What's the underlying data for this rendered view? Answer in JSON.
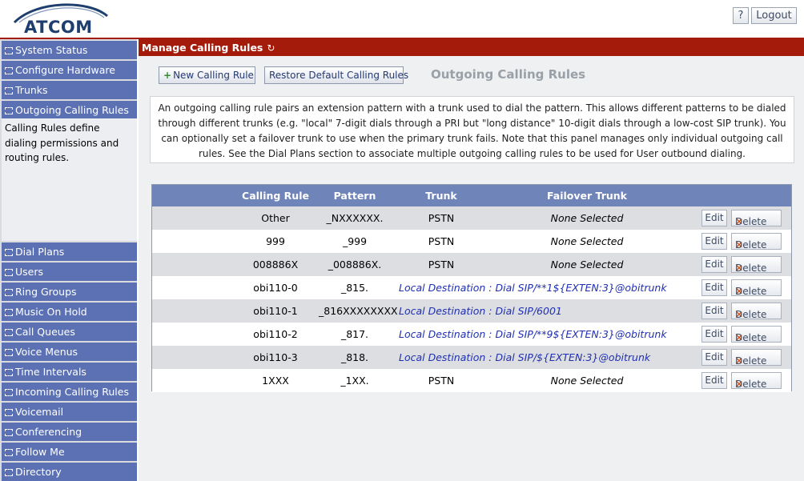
{
  "header": {
    "logo_text": "ATCOM",
    "help_label": "?",
    "logout_label": "Logout"
  },
  "sidebar": {
    "top_items": [
      {
        "label": "System Status"
      },
      {
        "label": "Configure Hardware"
      },
      {
        "label": "Trunks"
      },
      {
        "label": "Outgoing Calling Rules"
      }
    ],
    "description": "Calling Rules define dialing permissions and routing rules.",
    "bottom_items": [
      {
        "label": "Dial Plans"
      },
      {
        "label": "Users"
      },
      {
        "label": "Ring Groups"
      },
      {
        "label": "Music On Hold"
      },
      {
        "label": "Call Queues"
      },
      {
        "label": "Voice Menus"
      },
      {
        "label": "Time Intervals"
      },
      {
        "label": "Incoming Calling Rules"
      },
      {
        "label": "Voicemail"
      },
      {
        "label": "Conferencing"
      },
      {
        "label": "Follow Me"
      },
      {
        "label": "Directory"
      }
    ]
  },
  "page": {
    "title": "Manage Calling Rules",
    "refresh_icon": "refresh-icon",
    "new_rule_label": "New Calling Rule",
    "restore_label": "Restore Default Calling Rules",
    "section_title": "Outgoing Calling Rules",
    "description": "An outgoing calling rule pairs an extension pattern with a trunk used to dial the pattern. This allows different patterns to be dialed through different trunks (e.g. \"local\" 7-digit dials through a PRI but \"long distance\" 10-digit dials through a low-cost SIP trunk). You can optionally set a failover trunk to use when the primary trunk fails. Note that this panel manages only individual outgoing call rules. See the Dial Plans section to associate multiple outgoing calling rules to be used for User outbound dialing."
  },
  "table": {
    "headers": {
      "rule": "Calling Rule",
      "pattern": "Pattern",
      "trunk": "Trunk",
      "failover": "Failover Trunk"
    },
    "edit_label": "Edit",
    "delete_label": "Delete",
    "rows": [
      {
        "rule": "Other",
        "pattern": "_NXXXXXX.",
        "trunk": "PSTN",
        "failover": "None Selected"
      },
      {
        "rule": "999",
        "pattern": "_999",
        "trunk": "PSTN",
        "failover": "None Selected"
      },
      {
        "rule": "008886X",
        "pattern": "_008886X.",
        "trunk": "PSTN",
        "failover": "None Selected"
      },
      {
        "rule": "obi110-0",
        "pattern": "_815.",
        "local": "Local Destination : Dial SIP/**1${EXTEN:3}@obitrunk"
      },
      {
        "rule": "obi110-1",
        "pattern": "_816XXXXXXXX",
        "local": "Local Destination : Dial SIP/6001"
      },
      {
        "rule": "obi110-2",
        "pattern": "_817.",
        "local": "Local Destination : Dial SIP/**9${EXTEN:3}@obitrunk"
      },
      {
        "rule": "obi110-3",
        "pattern": "_818.",
        "local": "Local Destination : Dial SIP/${EXTEN:3}@obitrunk"
      },
      {
        "rule": "1XXX",
        "pattern": "_1XX.",
        "trunk": "PSTN",
        "failover": "None Selected"
      }
    ]
  },
  "colors": {
    "accent_red": "#a51b0b",
    "nav_blue": "#5b71b3",
    "table_header": "#6f84b8",
    "local_link": "#1f2fb0"
  }
}
